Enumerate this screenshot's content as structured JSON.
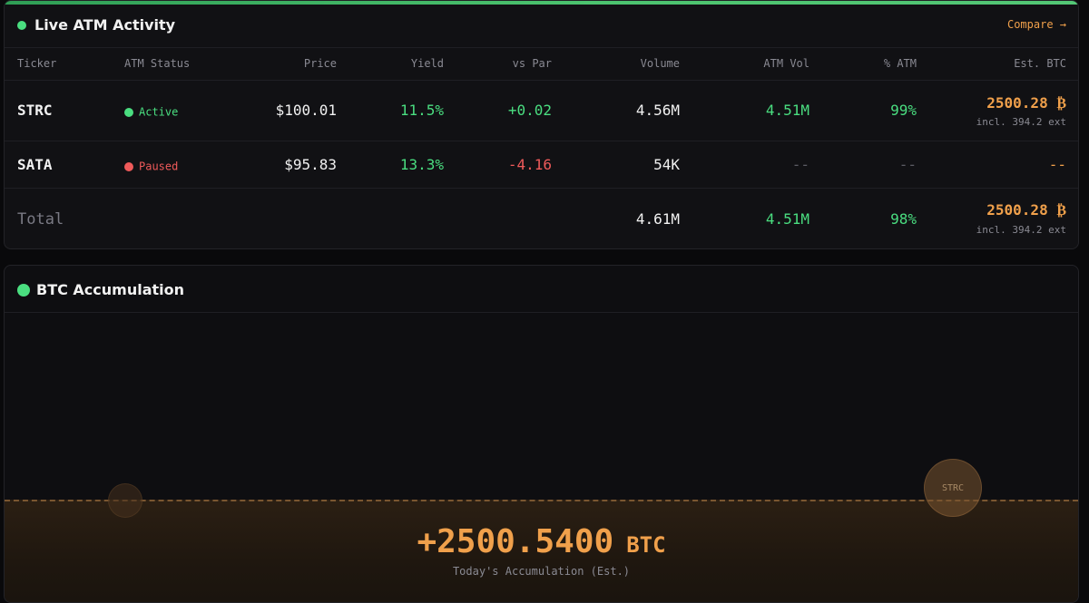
{
  "atm_panel": {
    "title": "Live ATM Activity",
    "compare_link": "Compare →",
    "columns": [
      "Ticker",
      "ATM Status",
      "Price",
      "Yield",
      "vs Par",
      "Volume",
      "ATM Vol",
      "% ATM",
      "Est. BTC"
    ],
    "rows": [
      {
        "ticker": "STRC",
        "status": "Active",
        "status_color": "#4ade80",
        "price": "$100.01",
        "yield": "11.5%",
        "vs_par": "+0.02",
        "volume": "4.56M",
        "atm_vol": "4.51M",
        "pct_atm": "99%",
        "est_btc": "2500.28 ₿",
        "est_btc_note": "incl. 394.2 ext"
      },
      {
        "ticker": "SATA",
        "status": "Paused",
        "status_color": "#ef5a5a",
        "price": "$95.83",
        "yield": "13.3%",
        "vs_par": "-4.16",
        "volume": "54K",
        "atm_vol": "--",
        "pct_atm": "--",
        "est_btc": "--"
      }
    ],
    "total": {
      "label": "Total",
      "volume": "4.61M",
      "atm_vol": "4.51M",
      "pct_atm": "98%",
      "est_btc": "2500.28 ₿",
      "est_btc_note": "incl. 394.2 ext"
    }
  },
  "accum_panel": {
    "title": "BTC Accumulation",
    "bubbles": [
      {
        "label": "STRC"
      },
      {
        "label": ""
      }
    ],
    "value": "+2500.5400",
    "unit": "BTC",
    "caption": "Today's Accumulation (Est.)"
  },
  "colors": {
    "accent_green": "#4ade80",
    "accent_orange": "#f0a04b",
    "negative_red": "#ef5a5a"
  }
}
